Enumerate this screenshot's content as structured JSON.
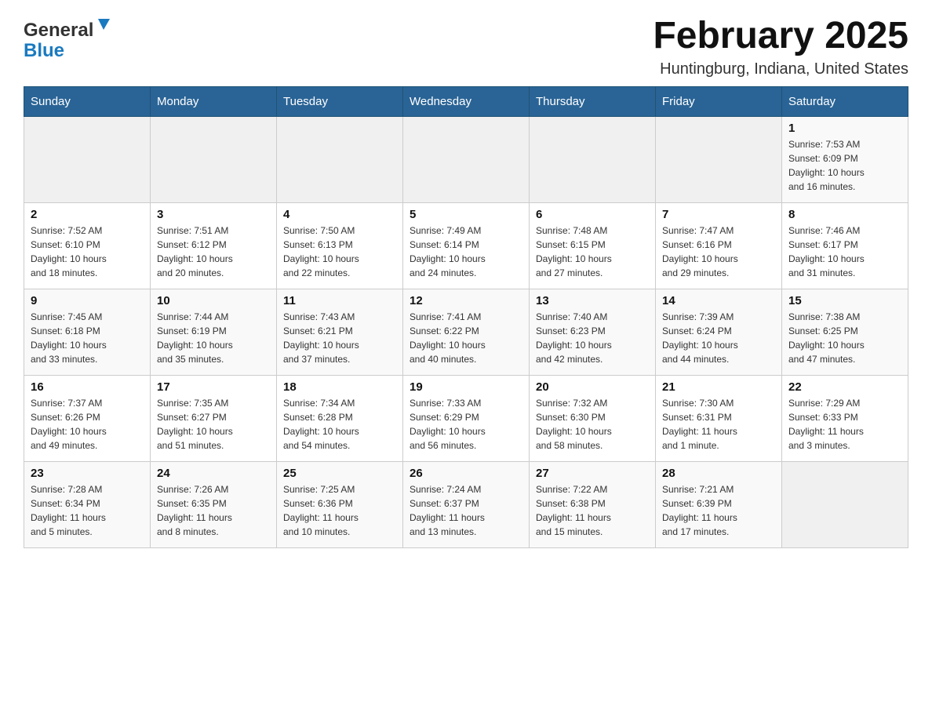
{
  "header": {
    "logo_general": "General",
    "logo_blue": "Blue",
    "month_title": "February 2025",
    "location": "Huntingburg, Indiana, United States"
  },
  "days_of_week": [
    "Sunday",
    "Monday",
    "Tuesday",
    "Wednesday",
    "Thursday",
    "Friday",
    "Saturday"
  ],
  "weeks": [
    {
      "days": [
        {
          "number": "",
          "info": "",
          "empty": true
        },
        {
          "number": "",
          "info": "",
          "empty": true
        },
        {
          "number": "",
          "info": "",
          "empty": true
        },
        {
          "number": "",
          "info": "",
          "empty": true
        },
        {
          "number": "",
          "info": "",
          "empty": true
        },
        {
          "number": "",
          "info": "",
          "empty": true
        },
        {
          "number": "1",
          "info": "Sunrise: 7:53 AM\nSunset: 6:09 PM\nDaylight: 10 hours\nand 16 minutes.",
          "empty": false
        }
      ]
    },
    {
      "days": [
        {
          "number": "2",
          "info": "Sunrise: 7:52 AM\nSunset: 6:10 PM\nDaylight: 10 hours\nand 18 minutes.",
          "empty": false
        },
        {
          "number": "3",
          "info": "Sunrise: 7:51 AM\nSunset: 6:12 PM\nDaylight: 10 hours\nand 20 minutes.",
          "empty": false
        },
        {
          "number": "4",
          "info": "Sunrise: 7:50 AM\nSunset: 6:13 PM\nDaylight: 10 hours\nand 22 minutes.",
          "empty": false
        },
        {
          "number": "5",
          "info": "Sunrise: 7:49 AM\nSunset: 6:14 PM\nDaylight: 10 hours\nand 24 minutes.",
          "empty": false
        },
        {
          "number": "6",
          "info": "Sunrise: 7:48 AM\nSunset: 6:15 PM\nDaylight: 10 hours\nand 27 minutes.",
          "empty": false
        },
        {
          "number": "7",
          "info": "Sunrise: 7:47 AM\nSunset: 6:16 PM\nDaylight: 10 hours\nand 29 minutes.",
          "empty": false
        },
        {
          "number": "8",
          "info": "Sunrise: 7:46 AM\nSunset: 6:17 PM\nDaylight: 10 hours\nand 31 minutes.",
          "empty": false
        }
      ]
    },
    {
      "days": [
        {
          "number": "9",
          "info": "Sunrise: 7:45 AM\nSunset: 6:18 PM\nDaylight: 10 hours\nand 33 minutes.",
          "empty": false
        },
        {
          "number": "10",
          "info": "Sunrise: 7:44 AM\nSunset: 6:19 PM\nDaylight: 10 hours\nand 35 minutes.",
          "empty": false
        },
        {
          "number": "11",
          "info": "Sunrise: 7:43 AM\nSunset: 6:21 PM\nDaylight: 10 hours\nand 37 minutes.",
          "empty": false
        },
        {
          "number": "12",
          "info": "Sunrise: 7:41 AM\nSunset: 6:22 PM\nDaylight: 10 hours\nand 40 minutes.",
          "empty": false
        },
        {
          "number": "13",
          "info": "Sunrise: 7:40 AM\nSunset: 6:23 PM\nDaylight: 10 hours\nand 42 minutes.",
          "empty": false
        },
        {
          "number": "14",
          "info": "Sunrise: 7:39 AM\nSunset: 6:24 PM\nDaylight: 10 hours\nand 44 minutes.",
          "empty": false
        },
        {
          "number": "15",
          "info": "Sunrise: 7:38 AM\nSunset: 6:25 PM\nDaylight: 10 hours\nand 47 minutes.",
          "empty": false
        }
      ]
    },
    {
      "days": [
        {
          "number": "16",
          "info": "Sunrise: 7:37 AM\nSunset: 6:26 PM\nDaylight: 10 hours\nand 49 minutes.",
          "empty": false
        },
        {
          "number": "17",
          "info": "Sunrise: 7:35 AM\nSunset: 6:27 PM\nDaylight: 10 hours\nand 51 minutes.",
          "empty": false
        },
        {
          "number": "18",
          "info": "Sunrise: 7:34 AM\nSunset: 6:28 PM\nDaylight: 10 hours\nand 54 minutes.",
          "empty": false
        },
        {
          "number": "19",
          "info": "Sunrise: 7:33 AM\nSunset: 6:29 PM\nDaylight: 10 hours\nand 56 minutes.",
          "empty": false
        },
        {
          "number": "20",
          "info": "Sunrise: 7:32 AM\nSunset: 6:30 PM\nDaylight: 10 hours\nand 58 minutes.",
          "empty": false
        },
        {
          "number": "21",
          "info": "Sunrise: 7:30 AM\nSunset: 6:31 PM\nDaylight: 11 hours\nand 1 minute.",
          "empty": false
        },
        {
          "number": "22",
          "info": "Sunrise: 7:29 AM\nSunset: 6:33 PM\nDaylight: 11 hours\nand 3 minutes.",
          "empty": false
        }
      ]
    },
    {
      "days": [
        {
          "number": "23",
          "info": "Sunrise: 7:28 AM\nSunset: 6:34 PM\nDaylight: 11 hours\nand 5 minutes.",
          "empty": false
        },
        {
          "number": "24",
          "info": "Sunrise: 7:26 AM\nSunset: 6:35 PM\nDaylight: 11 hours\nand 8 minutes.",
          "empty": false
        },
        {
          "number": "25",
          "info": "Sunrise: 7:25 AM\nSunset: 6:36 PM\nDaylight: 11 hours\nand 10 minutes.",
          "empty": false
        },
        {
          "number": "26",
          "info": "Sunrise: 7:24 AM\nSunset: 6:37 PM\nDaylight: 11 hours\nand 13 minutes.",
          "empty": false
        },
        {
          "number": "27",
          "info": "Sunrise: 7:22 AM\nSunset: 6:38 PM\nDaylight: 11 hours\nand 15 minutes.",
          "empty": false
        },
        {
          "number": "28",
          "info": "Sunrise: 7:21 AM\nSunset: 6:39 PM\nDaylight: 11 hours\nand 17 minutes.",
          "empty": false
        },
        {
          "number": "",
          "info": "",
          "empty": true
        }
      ]
    }
  ]
}
